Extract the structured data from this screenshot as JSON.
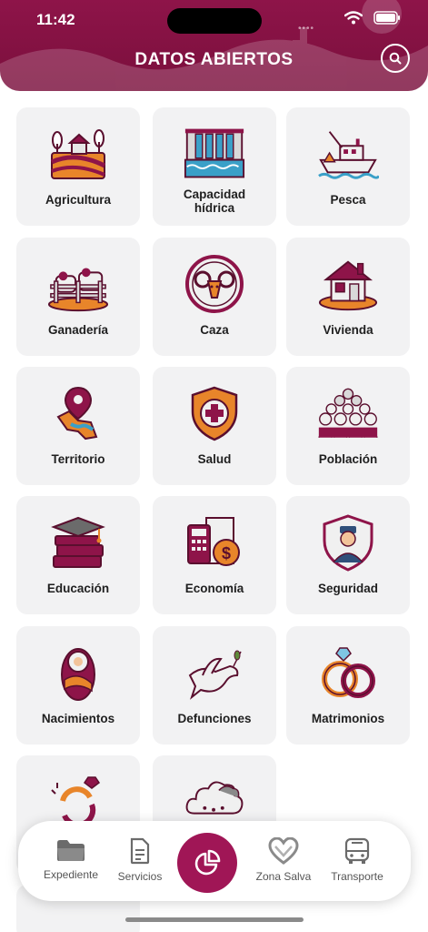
{
  "status_bar": {
    "time": "11:42"
  },
  "header": {
    "title": "DATOS ABIERTOS",
    "search_icon": "search-icon",
    "background": "#8e1449"
  },
  "tiles": [
    {
      "label": "Agricultura",
      "icon": "agriculture-icon"
    },
    {
      "label": "Capacidad hídrica",
      "icon": "dam-icon"
    },
    {
      "label": "Pesca",
      "icon": "fishing-boat-icon"
    },
    {
      "label": "Ganadería",
      "icon": "livestock-icon"
    },
    {
      "label": "Caza",
      "icon": "ram-icon"
    },
    {
      "label": "Vivienda",
      "icon": "house-icon"
    },
    {
      "label": "Territorio",
      "icon": "map-pin-icon"
    },
    {
      "label": "Salud",
      "icon": "health-shield-icon"
    },
    {
      "label": "Población",
      "icon": "population-icon"
    },
    {
      "label": "Educación",
      "icon": "graduation-books-icon"
    },
    {
      "label": "Economía",
      "icon": "economy-icon"
    },
    {
      "label": "Seguridad",
      "icon": "police-shield-icon"
    },
    {
      "label": "Nacimientos",
      "icon": "baby-icon"
    },
    {
      "label": "Defunciones",
      "icon": "dove-icon"
    },
    {
      "label": "Matrimonios",
      "icon": "wedding-rings-icon"
    },
    {
      "label": "",
      "icon": "broken-ring-icon"
    },
    {
      "label": "",
      "icon": "weather-cloud-icon"
    }
  ],
  "nav": {
    "items": [
      {
        "label": "Expediente",
        "icon": "folder-icon"
      },
      {
        "label": "Servicios",
        "icon": "document-icon"
      },
      {
        "label": "",
        "icon": "pie-chart-icon"
      },
      {
        "label": "Zona Salva",
        "icon": "heart-icon"
      },
      {
        "label": "Transporte",
        "icon": "bus-icon"
      }
    ]
  },
  "colors": {
    "primary": "#8e1449",
    "accent_orange": "#e8852a",
    "tile_bg": "#f2f2f3"
  }
}
